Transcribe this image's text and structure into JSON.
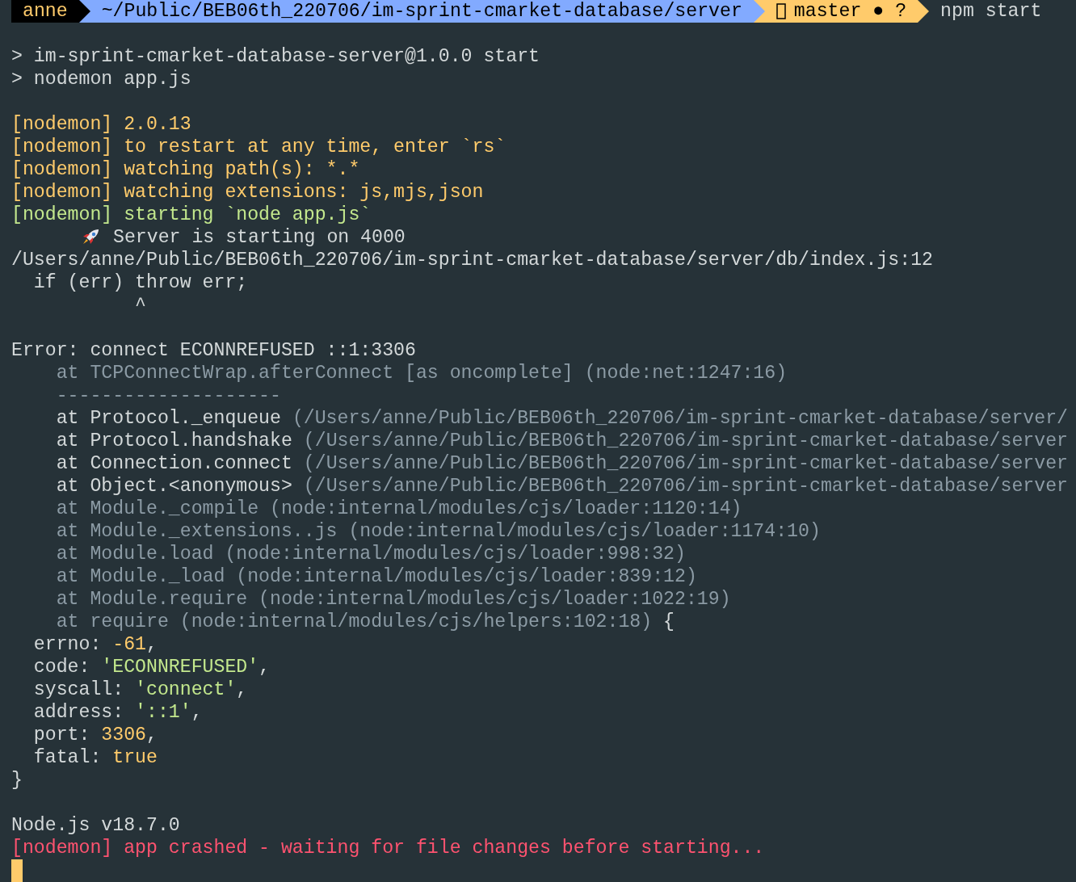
{
  "prompt": {
    "user": "anne",
    "path": "~/Public/BEB06th_220706/im-sprint-cmarket-database/server",
    "branch": "master",
    "status": "● ?",
    "command": "npm start"
  },
  "lines": [
    {
      "kind": "blank"
    },
    {
      "kind": "text",
      "segments": [
        {
          "text": "> im-sprint-cmarket-database-server@1.0.0 start",
          "kind": "plain"
        }
      ]
    },
    {
      "kind": "text",
      "segments": [
        {
          "text": "> nodemon app.js",
          "kind": "plain"
        }
      ]
    },
    {
      "kind": "blank"
    },
    {
      "kind": "text",
      "segments": [
        {
          "text": "[nodemon] 2.0.13",
          "kind": "nodemon"
        }
      ]
    },
    {
      "kind": "text",
      "segments": [
        {
          "text": "[nodemon] to restart at any time, enter `rs`",
          "kind": "nodemon"
        }
      ]
    },
    {
      "kind": "text",
      "segments": [
        {
          "text": "[nodemon] watching path(s): *.*",
          "kind": "nodemon"
        }
      ]
    },
    {
      "kind": "text",
      "segments": [
        {
          "text": "[nodemon] watching extensions: js,mjs,json",
          "kind": "nodemon"
        }
      ]
    },
    {
      "kind": "text",
      "segments": [
        {
          "text": "[nodemon] starting `node app.js`",
          "kind": "success"
        }
      ]
    },
    {
      "kind": "rocket",
      "segments": [
        {
          "text": "Server is starting on 4000",
          "kind": "plain"
        }
      ]
    },
    {
      "kind": "text",
      "segments": [
        {
          "text": "/Users/anne/Public/BEB06th_220706/im-sprint-cmarket-database/server/db/index.js:12",
          "kind": "plain"
        }
      ]
    },
    {
      "kind": "text",
      "segments": [
        {
          "text": "  if (err) throw err;",
          "kind": "plain"
        }
      ]
    },
    {
      "kind": "text",
      "segments": [
        {
          "text": "           ^",
          "kind": "plain"
        }
      ]
    },
    {
      "kind": "blank"
    },
    {
      "kind": "text",
      "segments": [
        {
          "text": "Error: connect ECONNREFUSED ::1:3306",
          "kind": "plain"
        }
      ]
    },
    {
      "kind": "text",
      "segments": [
        {
          "text": "    at TCPConnectWrap.afterConnect [as oncomplete] (node:net:1247:16)",
          "kind": "dim"
        }
      ]
    },
    {
      "kind": "text",
      "segments": [
        {
          "text": "    --------------------",
          "kind": "dim"
        }
      ]
    },
    {
      "kind": "text",
      "segments": [
        {
          "text": "    at Protocol._enqueue ",
          "kind": "plain"
        },
        {
          "text": "(/Users/anne/Public/BEB06th_220706/im-sprint-cmarket-database/server/",
          "kind": "dim"
        }
      ]
    },
    {
      "kind": "text",
      "segments": [
        {
          "text": "    at Protocol.handshake ",
          "kind": "plain"
        },
        {
          "text": "(/Users/anne/Public/BEB06th_220706/im-sprint-cmarket-database/server",
          "kind": "dim"
        }
      ]
    },
    {
      "kind": "text",
      "segments": [
        {
          "text": "    at Connection.connect ",
          "kind": "plain"
        },
        {
          "text": "(/Users/anne/Public/BEB06th_220706/im-sprint-cmarket-database/server",
          "kind": "dim"
        }
      ]
    },
    {
      "kind": "text",
      "segments": [
        {
          "text": "    at Object.<anonymous> ",
          "kind": "plain"
        },
        {
          "text": "(/Users/anne/Public/BEB06th_220706/im-sprint-cmarket-database/server",
          "kind": "dim"
        }
      ]
    },
    {
      "kind": "text",
      "segments": [
        {
          "text": "    at Module._compile (node:internal/modules/cjs/loader:1120:14)",
          "kind": "dim"
        }
      ]
    },
    {
      "kind": "text",
      "segments": [
        {
          "text": "    at Module._extensions..js (node:internal/modules/cjs/loader:1174:10)",
          "kind": "dim"
        }
      ]
    },
    {
      "kind": "text",
      "segments": [
        {
          "text": "    at Module.load (node:internal/modules/cjs/loader:998:32)",
          "kind": "dim"
        }
      ]
    },
    {
      "kind": "text",
      "segments": [
        {
          "text": "    at Module._load (node:internal/modules/cjs/loader:839:12)",
          "kind": "dim"
        }
      ]
    },
    {
      "kind": "text",
      "segments": [
        {
          "text": "    at Module.require (node:internal/modules/cjs/loader:1022:19)",
          "kind": "dim"
        }
      ]
    },
    {
      "kind": "text",
      "segments": [
        {
          "text": "    at require (node:internal/modules/cjs/helpers:102:18)",
          "kind": "dim"
        },
        {
          "text": " {",
          "kind": "plain"
        }
      ]
    },
    {
      "kind": "text",
      "segments": [
        {
          "text": "  errno: ",
          "kind": "plain"
        },
        {
          "text": "-61",
          "kind": "number"
        },
        {
          "text": ",",
          "kind": "plain"
        }
      ]
    },
    {
      "kind": "text",
      "segments": [
        {
          "text": "  code: ",
          "kind": "plain"
        },
        {
          "text": "'ECONNREFUSED'",
          "kind": "string"
        },
        {
          "text": ",",
          "kind": "plain"
        }
      ]
    },
    {
      "kind": "text",
      "segments": [
        {
          "text": "  syscall: ",
          "kind": "plain"
        },
        {
          "text": "'connect'",
          "kind": "string"
        },
        {
          "text": ",",
          "kind": "plain"
        }
      ]
    },
    {
      "kind": "text",
      "segments": [
        {
          "text": "  address: ",
          "kind": "plain"
        },
        {
          "text": "'::1'",
          "kind": "string"
        },
        {
          "text": ",",
          "kind": "plain"
        }
      ]
    },
    {
      "kind": "text",
      "segments": [
        {
          "text": "  port: ",
          "kind": "plain"
        },
        {
          "text": "3306",
          "kind": "number"
        },
        {
          "text": ",",
          "kind": "plain"
        }
      ]
    },
    {
      "kind": "text",
      "segments": [
        {
          "text": "  fatal: ",
          "kind": "plain"
        },
        {
          "text": "true",
          "kind": "number"
        }
      ]
    },
    {
      "kind": "text",
      "segments": [
        {
          "text": "}",
          "kind": "plain"
        }
      ]
    },
    {
      "kind": "blank"
    },
    {
      "kind": "text",
      "segments": [
        {
          "text": "Node.js v18.7.0",
          "kind": "plain"
        }
      ]
    },
    {
      "kind": "text",
      "segments": [
        {
          "text": "[nodemon] app crashed - waiting for file changes before starting...",
          "kind": "error"
        }
      ]
    },
    {
      "kind": "cursor"
    }
  ]
}
